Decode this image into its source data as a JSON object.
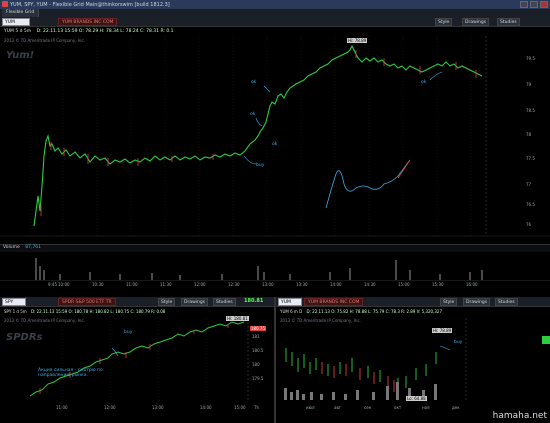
{
  "window": {
    "title": "YUM, SPY, YUM - Flexible Grid Main@thinkorswim [build 1812.3]",
    "tab_label": "Flexible Grid"
  },
  "main_chart": {
    "symbol": "YUM",
    "company": "YUM BRANDS INC COM",
    "timeframe": "YUM 5 d 5m",
    "quote": "D: 22.11.13 15:59 O: 78.29 H: 78.34 L: 78.24 C: 78.31 R: 0.1",
    "copyright": "2013 © TD Ameritrade IP Company, Inc.",
    "watermark": "Yum!",
    "buttons": [
      "Style",
      "Drawings",
      "Studies"
    ],
    "hi_label": "Hi: 78.89",
    "price_ticks": [
      "79.5",
      "79",
      "78.5",
      "78",
      "77.5",
      "77",
      "76.5",
      "76"
    ],
    "time_ticks": [
      "9:45",
      "10:00",
      "10:30",
      "11:00",
      "11:30",
      "12:00",
      "12:30",
      "13:00",
      "13:30",
      "14:00",
      "14:30",
      "15:00",
      "15:30",
      "16:00"
    ],
    "annotations": [
      "ok",
      "ok",
      "ok",
      "buy",
      "ok"
    ],
    "volume_label": "Volume",
    "volume_value": "87,761"
  },
  "bottom_left": {
    "symbol": "SPY",
    "company": "SPDR S&P 500 ETF TR",
    "timeframe": "SPY 1 d 5m",
    "quote": "D: 22.11.13 15:59 O: 180.78 H: 180.82 L: 180.75 C: 180.79 R: 0.08",
    "copyright": "2013 © TD Ameritrade IP Company, Inc.",
    "watermark": "SPDRs",
    "buttons": [
      "Style",
      "Drawings",
      "Studies"
    ],
    "last_price": "180.81",
    "hi_label": "Hi: 180.81",
    "price_tag": "180.75",
    "annotation_buy": "buy",
    "comment_lines": [
      "Акция сильная - смотрю по",
      "направлению рынка."
    ],
    "time_ticks": [
      "11:00",
      "12:00",
      "13:00",
      "14:00",
      "15:00",
      "Th"
    ],
    "price_ticks": [
      "181",
      "180.5",
      "180",
      "179.5"
    ]
  },
  "bottom_right": {
    "symbol": "YUM",
    "company": "YUM BRANDS INC COM",
    "timeframe": "YUM 6 m D",
    "quote": "D: 22.11.13 O: 75.82 H: 78.88 L: 75.79 C: 78.3 R: 2.89 V: 5,320,327",
    "copyright": "2013 © TD Ameritrade IP Company, Inc.",
    "buttons": [
      "Style",
      "Drawings",
      "Studies"
    ],
    "hi_label": "Hi: 78.89",
    "lo_label": "Lo: 64.88",
    "annotation_buy": "buy",
    "time_ticks": [
      "июл",
      "авг",
      "сен",
      "окт",
      "ноя",
      "дек"
    ]
  },
  "colors": {
    "title_bar": "#2a3a5a",
    "up": "#2ecc40",
    "down": "#e0403a",
    "annotation": "#3aaee8",
    "grid": "#2a2a2a"
  },
  "site_watermark": "hamaha.net"
}
